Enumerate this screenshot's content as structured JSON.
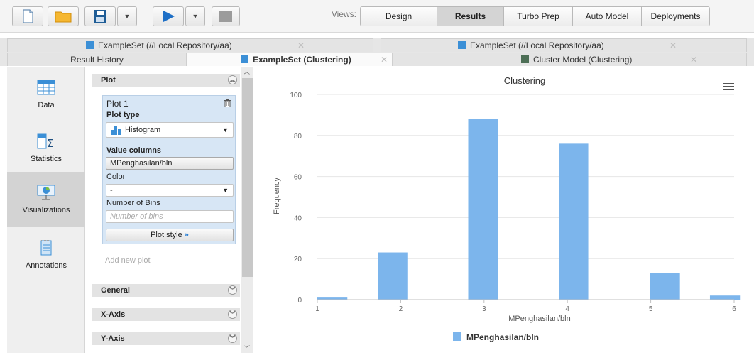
{
  "toolbar": {
    "views_label": "Views:",
    "views": [
      "Design",
      "Results",
      "Turbo Prep",
      "Auto Model",
      "Deployments"
    ],
    "active_view": "Results"
  },
  "tabs_row1": [
    {
      "label": "ExampleSet (//Local Repository/aa)"
    },
    {
      "label": "ExampleSet (//Local Repository/aa)"
    }
  ],
  "tabs_row2": [
    {
      "label": "Result History"
    },
    {
      "label": "ExampleSet (Clustering)"
    },
    {
      "label": "Cluster Model (Clustering)"
    }
  ],
  "leftnav": {
    "items": [
      {
        "label": "Data",
        "icon": "table-icon"
      },
      {
        "label": "Statistics",
        "icon": "statistics-icon"
      },
      {
        "label": "Visualizations",
        "icon": "pie-chart-icon"
      },
      {
        "label": "Annotations",
        "icon": "notes-icon"
      }
    ],
    "active": "Visualizations"
  },
  "config": {
    "plot_header": "Plot",
    "plot_card": {
      "title": "Plot 1",
      "plot_type_label": "Plot type",
      "plot_type_value": "Histogram",
      "value_columns_label": "Value columns",
      "value_columns_value": "MPenghasilan/bln",
      "color_label": "Color",
      "color_value": "-",
      "bins_label": "Number of Bins",
      "bins_placeholder": "Number of bins",
      "plot_style_label": "Plot style"
    },
    "add_plot": "Add new plot",
    "sections": [
      "General",
      "X-Axis",
      "Y-Axis"
    ]
  },
  "chart_data": {
    "type": "bar",
    "title": "Clustering",
    "xlabel": "MPenghasilan/bln",
    "ylabel": "Frequency",
    "x_ticks": [
      1,
      2,
      3,
      4,
      5,
      6
    ],
    "y_ticks": [
      0,
      20,
      40,
      60,
      80,
      100
    ],
    "ylim": [
      0,
      100
    ],
    "xlim": [
      1,
      6
    ],
    "bins": [
      {
        "x0": 1.0,
        "x1": 1.36,
        "value": 1
      },
      {
        "x0": 1.73,
        "x1": 2.08,
        "value": 23
      },
      {
        "x0": 2.81,
        "x1": 3.17,
        "value": 88
      },
      {
        "x0": 3.9,
        "x1": 4.25,
        "value": 76
      },
      {
        "x0": 4.99,
        "x1": 5.35,
        "value": 13
      },
      {
        "x0": 5.71,
        "x1": 6.07,
        "value": 2
      }
    ],
    "series_name": "MPenghasilan/bln",
    "color": "#7cb5ec",
    "legend_position": "bottom"
  }
}
